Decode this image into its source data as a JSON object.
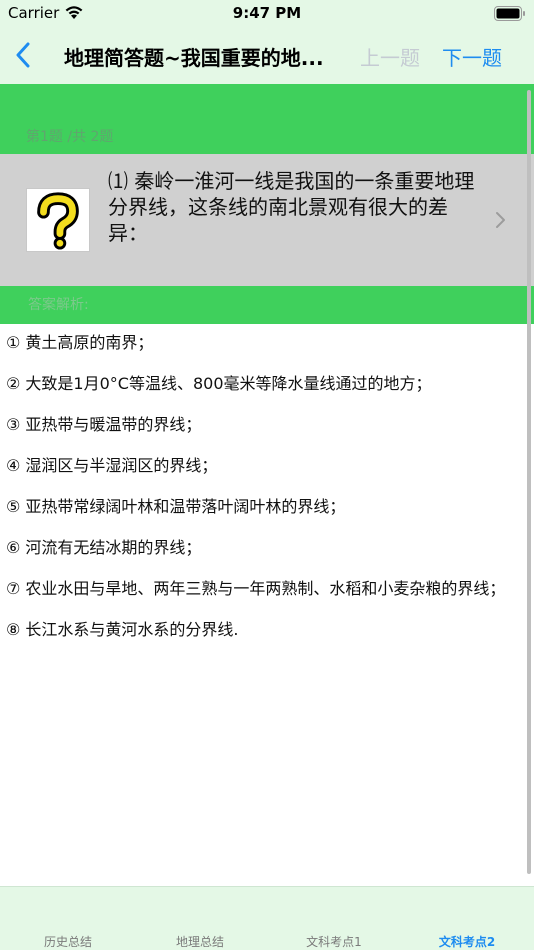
{
  "status_bar": {
    "carrier": "Carrier",
    "time": "9:47 PM",
    "icons": [
      "wifi-icon",
      "battery-icon"
    ]
  },
  "nav": {
    "back_icon": "chevron-left-icon",
    "title": "地理简答题~我国重要的地...",
    "prev_label": "上一题",
    "next_label": "下一题",
    "prev_enabled": false
  },
  "question": {
    "progress": "第1题 /共 2题",
    "text": "⑴ 秦岭一淮河一线是我国的一条重要地理分界线，这条线的南北景观有很大的差异：",
    "thumbnail_icon": "question-mark-icon",
    "disclosure_icon": "chevron-right-icon"
  },
  "answer": {
    "header": "答案解析:",
    "lines": [
      "① 黄土高原的南界；",
      "② 大致是1月0°C等温线、800毫米等降水量线通过的地方；",
      "③ 亚热带与暖温带的界线；",
      "④ 湿润区与半湿润区的界线；",
      "⑤ 亚热带常绿阔叶林和温带落叶阔叶林的界线；",
      "⑥ 河流有无结冰期的界线；",
      "⑦ 农业水田与旱地、两年三熟与一年两熟制、水稻和小麦杂粮的界线；",
      "⑧ 长江水系与黄河水系的分界线."
    ]
  },
  "tabs": [
    {
      "label": "历史总结",
      "active": false
    },
    {
      "label": "地理总结",
      "active": false
    },
    {
      "label": "文科考点1",
      "active": false
    },
    {
      "label": "文科考点2",
      "active": true
    }
  ],
  "colors": {
    "green": "#3fd05c",
    "light_green": "#e4f8e6",
    "accent_blue": "#1e8cf0",
    "disabled_gray": "#c5cbd3",
    "question_bg": "#d0d0d0",
    "thumb_yellow": "#f3dd1e"
  }
}
